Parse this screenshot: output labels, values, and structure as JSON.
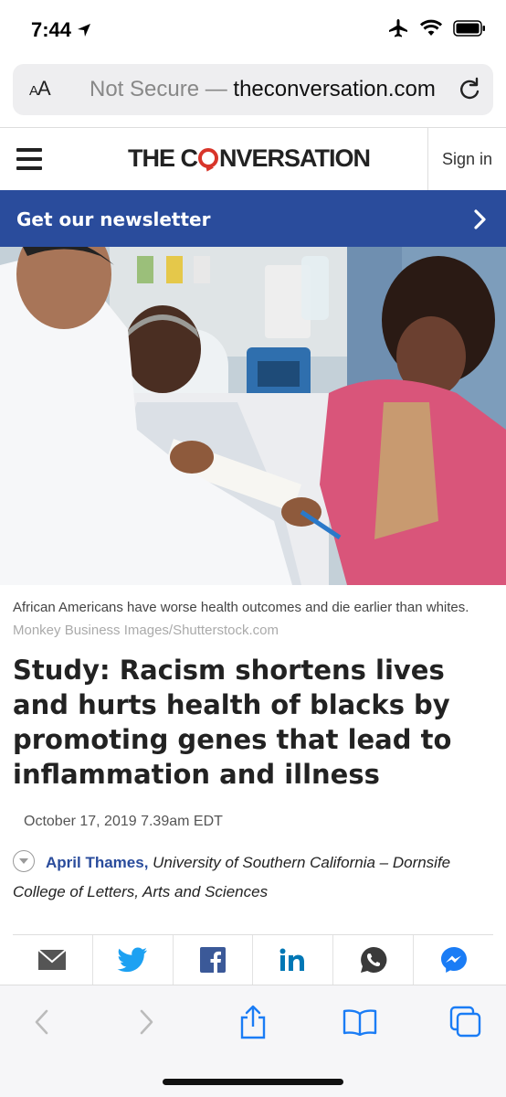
{
  "status_bar": {
    "time": "7:44"
  },
  "browser": {
    "text_size_label": "AA",
    "security_label": "Not Secure",
    "separator": " — ",
    "host": "theconversation.com"
  },
  "site": {
    "logo_pre": "THE C",
    "logo_post": "NVERSATION",
    "sign_in": "Sign in",
    "newsletter": "Get our newsletter"
  },
  "article": {
    "caption": "African Americans have worse health outcomes and die earlier than whites.",
    "credit": "Monkey Business Images/Shutterstock.com",
    "headline": "Study: Racism shortens lives and hurts health of blacks by promoting genes that lead to inflammation and illness",
    "date": "October 17, 2019 7.39am EDT",
    "author_name": "April Thames,",
    "author_affiliation": "University of Southern California – Dornsife College of Letters, Arts and Sciences"
  },
  "share_icons": [
    "email-icon",
    "twitter-icon",
    "facebook-icon",
    "linkedin-icon",
    "whatsapp-icon",
    "messenger-icon"
  ],
  "colors": {
    "brand_blue": "#2a4c9c",
    "logo_red": "#d8352a",
    "safari_blue": "#1a7cf5"
  }
}
